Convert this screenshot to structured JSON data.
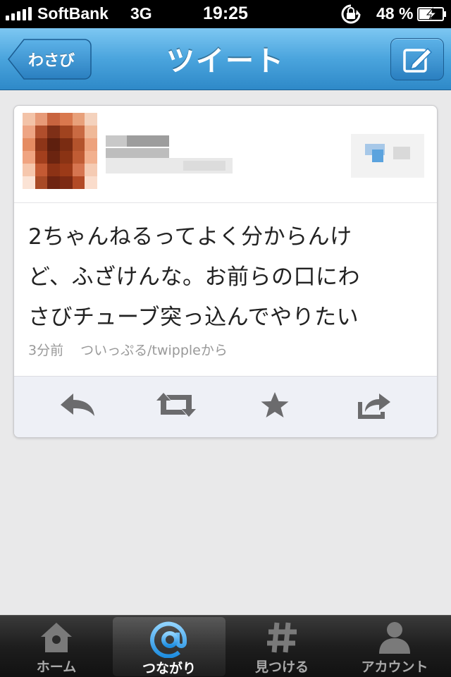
{
  "status_bar": {
    "carrier": "SoftBank",
    "network": "3G",
    "time": "19:25",
    "battery": "48 %"
  },
  "nav": {
    "back_label": "わさび",
    "title": "ツイート",
    "compose_icon": "compose-icon"
  },
  "tweet": {
    "lines": [
      "2ちゃんねるってよく分からんけ",
      "ど、ふざけんな。お前らの口にわ",
      "さびチューブ突っ込んでやりたい"
    ],
    "time_ago": "3分前",
    "via": "ついっぷる/twippleから",
    "actions": [
      "reply-icon",
      "retweet-icon",
      "favorite-star-icon",
      "share-icon"
    ]
  },
  "tabs": [
    {
      "label": "ホーム",
      "icon": "home-icon",
      "active": false
    },
    {
      "label": "つながり",
      "icon": "at-mention-icon",
      "active": true
    },
    {
      "label": "見つける",
      "icon": "hashtag-icon",
      "active": false
    },
    {
      "label": "アカウント",
      "icon": "person-icon",
      "active": false
    }
  ],
  "colors": {
    "nav_blue": "#4aa4dd",
    "active_tab_blue": "#3aa9ee",
    "background": "#e9e9ea"
  }
}
